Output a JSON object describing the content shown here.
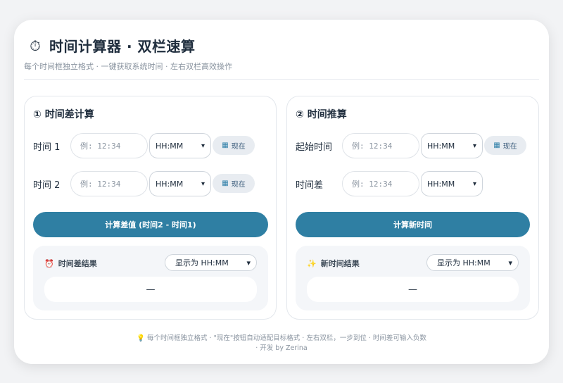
{
  "header": {
    "icon": "stopwatch-icon",
    "title": "时间计算器 · 双栏速算",
    "subtitle": "每个时间框独立格式 · 一键获取系统时间 · 左右双栏高效操作"
  },
  "left_panel": {
    "title": "① 时间差计算",
    "rows": [
      {
        "label": "时间 1",
        "placeholder": "例: 12:34",
        "format": "HH:MM",
        "now_label": "现在"
      },
      {
        "label": "时间 2",
        "placeholder": "例: 12:34",
        "format": "HH:MM",
        "now_label": "现在"
      }
    ],
    "calc_label": "计算差值 (时间2 - 时间1)",
    "result": {
      "icon": "alarm-clock-icon",
      "title": "时间差结果",
      "display_option": "显示为 HH:MM",
      "value": "—"
    }
  },
  "right_panel": {
    "title": "② 时间推算",
    "rows": [
      {
        "label": "起始时间",
        "placeholder": "例: 12:34",
        "format": "HH:MM",
        "now_label": "现在"
      },
      {
        "label": "时间差",
        "placeholder": "例: 12:34",
        "format": "HH:MM"
      }
    ],
    "calc_label": "计算新时间",
    "result": {
      "icon": "sparkles-icon",
      "title": "新时间结果",
      "display_option": "显示为 HH:MM",
      "value": "—"
    }
  },
  "footer": {
    "line1": "每个时间框独立格式 · \"现在\"按钮自动适配目标格式 · 左右双栏，一步到位 · 时间差可输入负数",
    "line2": "· 开发 by Zerina"
  },
  "colors": {
    "accent": "#2f7fa3",
    "background": "#f2f3f5",
    "panel_border": "#e3e7ec"
  }
}
